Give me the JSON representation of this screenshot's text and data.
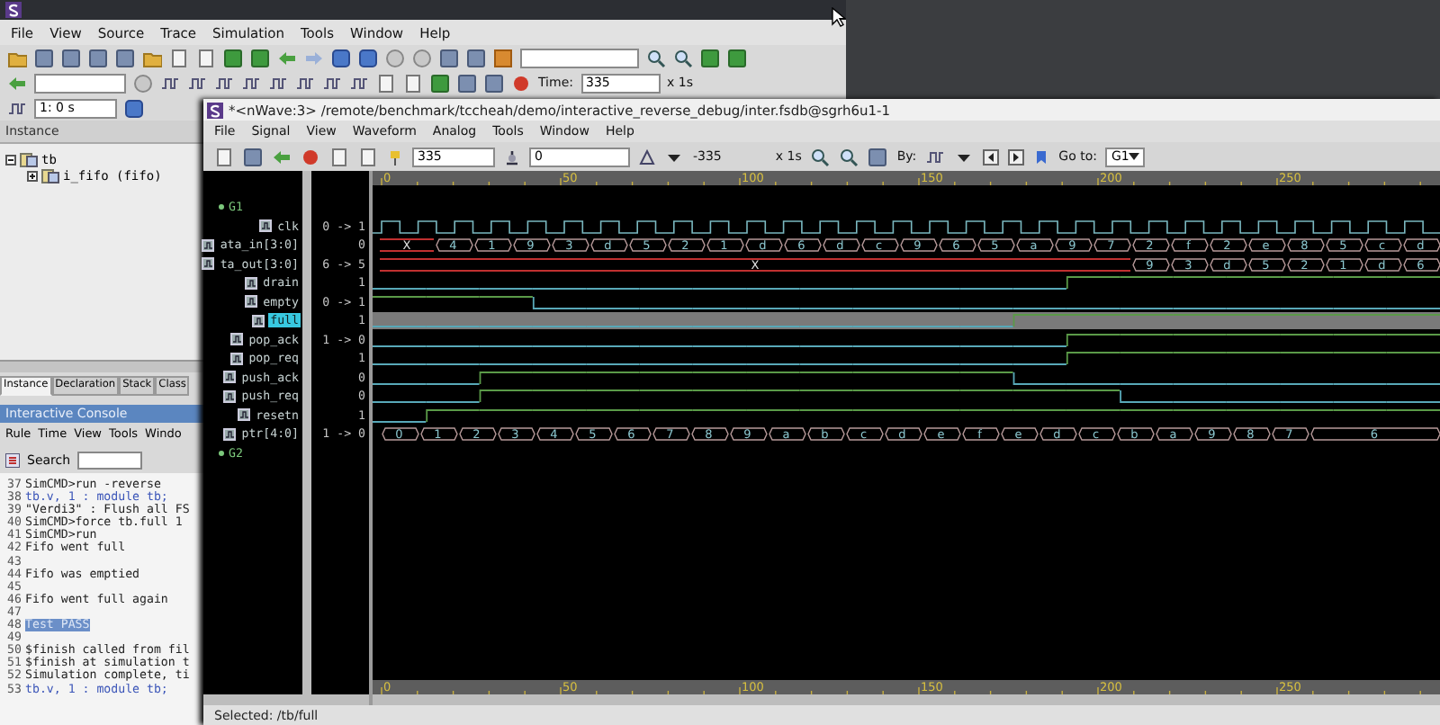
{
  "main_window": {
    "menu": [
      "File",
      "View",
      "Source",
      "Trace",
      "Simulation",
      "Tools",
      "Window",
      "Help"
    ],
    "time_field": {
      "label": "Time:",
      "value": "335",
      "unit": "x 1s"
    },
    "time_step": "1: 0 s",
    "instance_panel": {
      "title": "Instance",
      "tree": [
        {
          "label": "tb",
          "expanded": true,
          "children": [
            {
              "label": "i_fifo (fifo)",
              "expanded": false
            }
          ]
        }
      ]
    },
    "tabs": [
      {
        "label": "Instance",
        "selected": true
      },
      {
        "label": "Declaration",
        "selected": false
      },
      {
        "label": "Stack",
        "selected": false
      },
      {
        "label": "Class",
        "selected": false
      }
    ],
    "console": {
      "title": "Interactive Console",
      "menu": [
        "Rule",
        "Time",
        "View",
        "Tools",
        "Windo"
      ],
      "search_label": "Search",
      "lines": [
        {
          "number": "37",
          "text": "SimCMD>run -reverse",
          "kind": "plain"
        },
        {
          "number": "38",
          "text": "tb.v, 1 : module tb;",
          "kind": "link"
        },
        {
          "number": "39",
          "text": "\"Verdi3\" : Flush all FS",
          "kind": "plain"
        },
        {
          "number": "40",
          "text": "SimCMD>force tb.full 1",
          "kind": "plain"
        },
        {
          "number": "41",
          "text": "SimCMD>run",
          "kind": "plain"
        },
        {
          "number": "42",
          "text": "Fifo went full",
          "kind": "plain"
        },
        {
          "number": "43"
        },
        {
          "number": "44",
          "text": "Fifo was emptied",
          "kind": "plain"
        },
        {
          "number": "45"
        },
        {
          "number": "46",
          "text": "Fifo went full again",
          "kind": "plain"
        },
        {
          "number": "47"
        },
        {
          "number": "48",
          "text": "Test PASS",
          "kind": "selected"
        },
        {
          "number": "49"
        },
        {
          "number": "50",
          "text": "$finish called from fil",
          "kind": "plain"
        },
        {
          "number": "51",
          "text": "$finish at simulation t",
          "kind": "plain"
        },
        {
          "number": "52",
          "text": "Simulation complete, ti",
          "kind": "plain"
        },
        {
          "number": "53",
          "text": "tb.v, 1 : module tb;",
          "kind": "link"
        }
      ]
    }
  },
  "wave_window": {
    "title": "*<nWave:3> /remote/benchmark/tccheah/demo/interactive_reverse_debug/inter.fsdb@sgrh6u1-1",
    "menu": [
      "File",
      "Signal",
      "View",
      "Waveform",
      "Analog",
      "Tools",
      "Window",
      "Help"
    ],
    "toolbar": {
      "cursor": "335",
      "marker": "0",
      "delta": "-335",
      "unit": "x 1s",
      "by_label": "By:",
      "goto_label": "Go to:",
      "goto_value": "G1"
    },
    "top_ruler_ticks": [
      "0",
      "50",
      "100",
      "150",
      "200",
      "250"
    ],
    "bottom_ruler_ticks": [
      "0",
      "50",
      "100",
      "150",
      "200",
      "250"
    ],
    "signals": [
      {
        "kind": "group",
        "name": "G1",
        "selected": false
      },
      {
        "kind": "clock",
        "name": "clk",
        "value": "0 -> 1",
        "selected": false
      },
      {
        "kind": "bus",
        "name": "ata_in[3:0]",
        "value": "0",
        "selected": false,
        "segments": [
          {
            "text": "X",
            "unknown": true
          },
          {
            "text": "4",
            "unknown": false
          },
          {
            "text": "1",
            "unknown": false
          },
          {
            "text": "9",
            "unknown": false
          },
          {
            "text": "3",
            "unknown": false
          },
          {
            "text": "d",
            "unknown": false
          },
          {
            "text": "5",
            "unknown": false
          },
          {
            "text": "2",
            "unknown": false
          },
          {
            "text": "1",
            "unknown": false
          },
          {
            "text": "d",
            "unknown": false
          },
          {
            "text": "6",
            "unknown": false
          },
          {
            "text": "d",
            "unknown": false
          },
          {
            "text": "c",
            "unknown": false
          },
          {
            "text": "9",
            "unknown": false
          },
          {
            "text": "6",
            "unknown": false
          },
          {
            "text": "5",
            "unknown": false
          },
          {
            "text": "a",
            "unknown": false
          },
          {
            "text": "9",
            "unknown": false
          },
          {
            "text": "7",
            "unknown": false
          },
          {
            "text": "2",
            "unknown": false
          },
          {
            "text": "f",
            "unknown": false
          },
          {
            "text": "2",
            "unknown": false
          },
          {
            "text": "e",
            "unknown": false
          },
          {
            "text": "8",
            "unknown": false
          },
          {
            "text": "5",
            "unknown": false
          },
          {
            "text": "c",
            "unknown": false
          },
          {
            "text": "d",
            "unknown": false
          }
        ]
      },
      {
        "kind": "bus",
        "name": "ta_out[3:0]",
        "value": "6 -> 5",
        "selected": false,
        "segments": [
          {
            "text": "X",
            "unknown": true
          },
          {
            "text": "9",
            "unknown": false
          },
          {
            "text": "3",
            "unknown": false
          },
          {
            "text": "d",
            "unknown": false
          },
          {
            "text": "5",
            "unknown": false
          },
          {
            "text": "2",
            "unknown": false
          },
          {
            "text": "1",
            "unknown": false
          },
          {
            "text": "d",
            "unknown": false
          },
          {
            "text": "6",
            "unknown": false
          }
        ]
      },
      {
        "kind": "bit",
        "name": "drain",
        "value": "1",
        "selected": false,
        "wave": [
          false,
          false,
          false,
          false,
          false,
          false,
          false,
          false,
          false,
          false,
          false,
          false,
          false,
          true,
          true,
          true,
          true,
          true,
          true,
          true
        ]
      },
      {
        "kind": "bit",
        "name": "empty",
        "value": "0 -> 1",
        "selected": false,
        "wave": [
          true,
          true,
          true,
          false,
          false,
          false,
          false,
          false,
          false,
          false,
          false,
          false,
          false,
          false,
          false,
          false,
          false,
          false,
          false,
          false
        ]
      },
      {
        "kind": "bit",
        "name": "full",
        "value": "1",
        "selected": true,
        "wave": [
          false,
          false,
          false,
          false,
          false,
          false,
          false,
          false,
          false,
          false,
          false,
          false,
          true,
          true,
          true,
          true,
          true,
          true,
          true,
          true
        ]
      },
      {
        "kind": "bit",
        "name": "pop_ack",
        "value": "1 -> 0",
        "selected": false,
        "wave": [
          false,
          false,
          false,
          false,
          false,
          false,
          false,
          false,
          false,
          false,
          false,
          false,
          false,
          true,
          true,
          true,
          true,
          true,
          true,
          true
        ]
      },
      {
        "kind": "bit",
        "name": "pop_req",
        "value": "1",
        "selected": false,
        "wave": [
          false,
          false,
          false,
          false,
          false,
          false,
          false,
          false,
          false,
          false,
          false,
          false,
          false,
          true,
          true,
          true,
          true,
          true,
          true,
          true
        ]
      },
      {
        "kind": "bit",
        "name": "push_ack",
        "value": "0",
        "selected": false,
        "wave": [
          false,
          false,
          true,
          true,
          true,
          true,
          true,
          true,
          true,
          true,
          true,
          true,
          false,
          false,
          false,
          false,
          false,
          false,
          false,
          false
        ]
      },
      {
        "kind": "bit",
        "name": "push_req",
        "value": "0",
        "selected": false,
        "wave": [
          false,
          false,
          true,
          true,
          true,
          true,
          true,
          true,
          true,
          true,
          true,
          true,
          true,
          true,
          false,
          false,
          false,
          false,
          false,
          false
        ]
      },
      {
        "kind": "bit",
        "name": "resetn",
        "value": "1",
        "selected": false,
        "wave": [
          false,
          true,
          true,
          true,
          true,
          true,
          true,
          true,
          true,
          true,
          true,
          true,
          true,
          true,
          true,
          true,
          true,
          true,
          true,
          true
        ]
      },
      {
        "kind": "bus",
        "name": "ptr[4:0]",
        "value": "1 -> 0",
        "selected": false,
        "segments": [
          {
            "text": "0",
            "unknown": false
          },
          {
            "text": "1",
            "unknown": false
          },
          {
            "text": "2",
            "unknown": false
          },
          {
            "text": "3",
            "unknown": false
          },
          {
            "text": "4",
            "unknown": false
          },
          {
            "text": "5",
            "unknown": false
          },
          {
            "text": "6",
            "unknown": false
          },
          {
            "text": "7",
            "unknown": false
          },
          {
            "text": "8",
            "unknown": false
          },
          {
            "text": "9",
            "unknown": false
          },
          {
            "text": "a",
            "unknown": false
          },
          {
            "text": "b",
            "unknown": false
          },
          {
            "text": "c",
            "unknown": false
          },
          {
            "text": "d",
            "unknown": false
          },
          {
            "text": "e",
            "unknown": false
          },
          {
            "text": "f",
            "unknown": false
          },
          {
            "text": "e",
            "unknown": false
          },
          {
            "text": "d",
            "unknown": false
          },
          {
            "text": "c",
            "unknown": false
          },
          {
            "text": "b",
            "unknown": false
          },
          {
            "text": "a",
            "unknown": false
          },
          {
            "text": "9",
            "unknown": false
          },
          {
            "text": "8",
            "unknown": false
          },
          {
            "text": "7",
            "unknown": false
          },
          {
            "text": "6",
            "unknown": false
          }
        ]
      },
      {
        "kind": "group",
        "name": "G2",
        "selected": false
      }
    ],
    "status": "Selected: /tb/full"
  }
}
